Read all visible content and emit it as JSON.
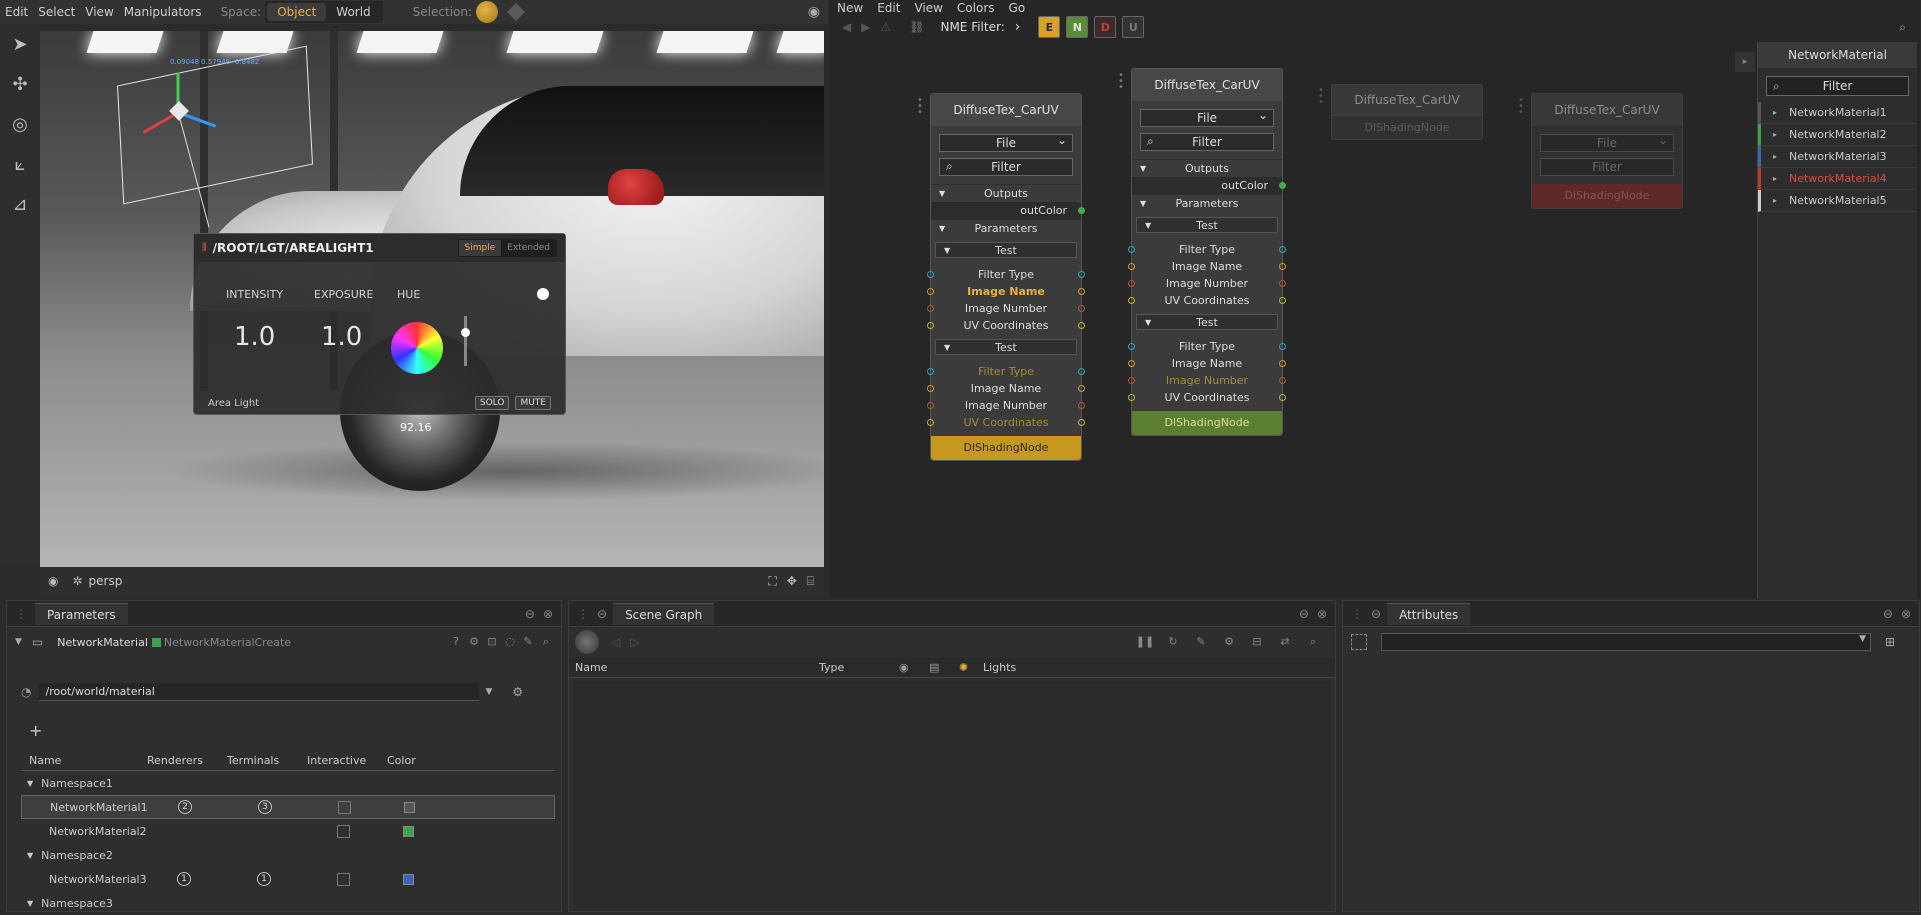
{
  "viewer": {
    "menu": [
      "Edit",
      "Select",
      "View",
      "Manipulators"
    ],
    "space_label": "Space:",
    "space_options": [
      "Object",
      "World"
    ],
    "space_selected": "Object",
    "selection_label": "Selection:",
    "readout": "0.09048  0.57948 -0.8482"
  },
  "light_panel": {
    "path": "/ROOT/LGT/AREALIGHT1",
    "modes": [
      "Simple",
      "Extended"
    ],
    "mode_selected": "Simple",
    "columns": [
      "INTENSITY",
      "EXPOSURE",
      "HUE"
    ],
    "intensity": "1.0",
    "exposure": "1.0",
    "type": "Area Light",
    "solo": "SOLO",
    "mute": "MUTE",
    "stray_value": "92.16"
  },
  "viewport_footer": {
    "camera": "persp"
  },
  "nme": {
    "menu": [
      "New",
      "Edit",
      "View",
      "Colors",
      "Go"
    ],
    "filter_label": "NME Filter:",
    "filters": [
      {
        "label": "E",
        "color": "#d6a22a",
        "text": "#2a2a2a"
      },
      {
        "label": "N",
        "color": "#5a8c3a",
        "text": "#e0e0e0"
      },
      {
        "label": "D",
        "color": "#3a2a2a",
        "text": "#c04040"
      },
      {
        "label": "U",
        "color": "#333333",
        "text": "#777777"
      }
    ],
    "nodes": [
      {
        "title": "DiffuseTex_CarUV",
        "file": "File",
        "filter": "Filter",
        "outputs": "Outputs",
        "out_color": "outColor",
        "parameters": "Parameters",
        "groups": [
          {
            "name": "Test",
            "params": [
              "Filter Type",
              "Image Name",
              "Image Number",
              "UV Coordinates"
            ],
            "highlight": [
              1
            ],
            "dim": []
          },
          {
            "name": "Test",
            "params": [
              "Filter Type",
              "Image Name",
              "Image Number",
              "UV Coordinates"
            ],
            "highlight": [],
            "dim": [
              0,
              3
            ]
          }
        ],
        "footer": "DlShadingNode",
        "footer_color": "#c7981f",
        "footer_text": "#2a2a2a"
      },
      {
        "title": "DiffuseTex_CarUV",
        "file": "File",
        "filter": "Filter",
        "outputs": "Outputs",
        "out_color": "outColor",
        "parameters": "Parameters",
        "groups": [
          {
            "name": "Test",
            "params": [
              "Filter Type",
              "Image Name",
              "Image Number",
              "UV Coordinates"
            ],
            "highlight": [],
            "dim": []
          },
          {
            "name": "Test",
            "params": [
              "Filter Type",
              "Image Name",
              "Image Number",
              "UV Coordinates"
            ],
            "highlight": [],
            "dim": [
              2
            ]
          }
        ],
        "footer": "DlShadingNode",
        "footer_color": "#5c7f2f",
        "footer_text": "#d9d9a6"
      },
      {
        "title": "DiffuseTex_CarUV",
        "footer": "DlShadingNode"
      },
      {
        "title": "DiffuseTex_CarUV",
        "file": "File",
        "filter": "Filter",
        "footer": "DlShadingNode"
      }
    ]
  },
  "network_panel": {
    "title": "NetworkMaterial",
    "filter": "Filter",
    "items": [
      {
        "label": "NetworkMaterial1",
        "color": "#cccccc",
        "bar": "#555555"
      },
      {
        "label": "NetworkMaterial2",
        "color": "#cccccc",
        "bar": "#3fa34d"
      },
      {
        "label": "NetworkMaterial3",
        "color": "#cccccc",
        "bar": "#3e66b0"
      },
      {
        "label": "NetworkMaterial4",
        "color": "#e04a3c",
        "bar": "#c0392b"
      },
      {
        "label": "NetworkMaterial5",
        "color": "#cccccc",
        "bar": "#cccccc"
      }
    ]
  },
  "parameters": {
    "tab": "Parameters",
    "node_name": "NetworkMaterial",
    "node_type": "NetworkMaterialCreate",
    "path": "/root/world/material",
    "plus": "+",
    "headers": [
      "Name",
      "Renderers",
      "Terminals",
      "Interactive",
      "Color"
    ],
    "rows": [
      {
        "kind": "ns",
        "name": "Namespace1"
      },
      {
        "kind": "item",
        "name": "NetworkMaterial1",
        "renderers": "2",
        "terminals": "3",
        "color": "#555555",
        "selected": true
      },
      {
        "kind": "item",
        "name": "NetworkMaterial2",
        "renderers": "",
        "terminals": "",
        "color": "#3fa34d",
        "selected": false
      },
      {
        "kind": "ns",
        "name": "Namespace2"
      },
      {
        "kind": "item",
        "name": "NetworkMaterial3",
        "renderers": "1",
        "terminals": "1",
        "color": "#3e66b0",
        "selected": false
      },
      {
        "kind": "ns",
        "name": "Namespace3"
      }
    ]
  },
  "scene_graph": {
    "tab": "Scene Graph",
    "columns": [
      "Name",
      "Type",
      "Lights"
    ]
  },
  "attributes": {
    "tab": "Attributes"
  }
}
